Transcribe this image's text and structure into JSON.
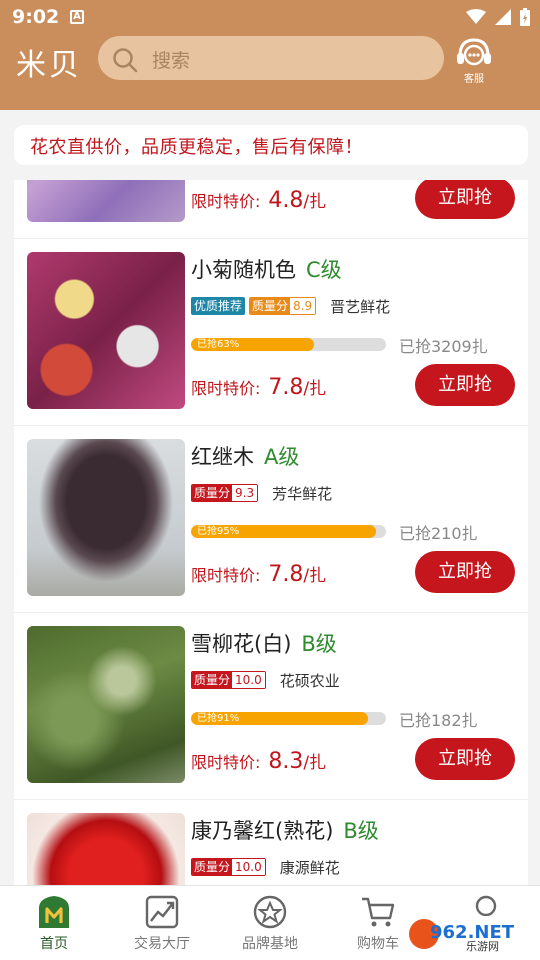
{
  "status": {
    "time": "9:02",
    "notif": "A"
  },
  "header": {
    "logo": "米贝",
    "search_placeholder": "搜索",
    "service_label": "客服"
  },
  "notice": "花农直供价，品质更稳定，售后有保障！",
  "partial_item": {
    "price_label": "限时特价:",
    "price": "4.8",
    "unit": "/扎",
    "buy_label": "立即抢"
  },
  "items": [
    {
      "name": "小菊随机色",
      "grade": "C级",
      "recommend": "优质推荐",
      "quality_label": "质量分",
      "quality": "8.9",
      "vendor": "晋艺鲜花",
      "progress_label": "已抢63%",
      "progress": 63,
      "sold": "已抢3209扎",
      "price_label": "限时特价:",
      "price": "7.8",
      "unit": "/扎",
      "buy_label": "立即抢"
    },
    {
      "name": "红继木",
      "grade": "A级",
      "quality_label": "质量分",
      "quality": "9.3",
      "vendor": "芳华鲜花",
      "progress_label": "已抢95%",
      "progress": 95,
      "sold": "已抢210扎",
      "price_label": "限时特价:",
      "price": "7.8",
      "unit": "/扎",
      "buy_label": "立即抢"
    },
    {
      "name": "雪柳花(白)",
      "grade": "B级",
      "quality_label": "质量分",
      "quality": "10.0",
      "vendor": "花硕农业",
      "progress_label": "已抢91%",
      "progress": 91,
      "sold": "已抢182扎",
      "price_label": "限时特价:",
      "price": "8.3",
      "unit": "/扎",
      "buy_label": "立即抢"
    },
    {
      "name": "康乃馨红(熟花)",
      "grade": "B级",
      "quality_label": "质量分",
      "quality": "10.0",
      "vendor": "康源鲜花"
    }
  ],
  "nav": [
    {
      "label": "首页",
      "icon": "home-icon"
    },
    {
      "label": "交易大厅",
      "icon": "chart-icon"
    },
    {
      "label": "品牌基地",
      "icon": "badge-icon"
    },
    {
      "label": "购物车",
      "icon": "cart-icon"
    }
  ],
  "watermark": {
    "text": "962.NET",
    "subtext": "乐游网"
  },
  "colors": {
    "brand": "#c98e5c",
    "accent_red": "#c4161c",
    "grade_green": "#2e8b2e",
    "progress": "#f7a400"
  }
}
